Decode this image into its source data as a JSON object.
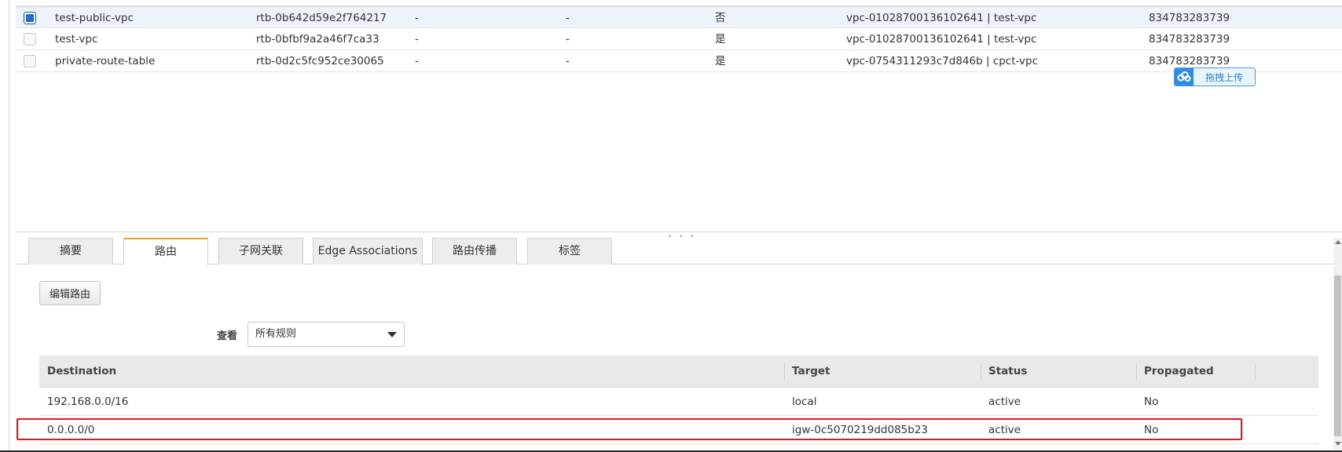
{
  "route_tables": [
    {
      "name": "test-public-vpc",
      "id": "rtb-0b642d59e2f764217",
      "col3": "-",
      "col4": "-",
      "main": "否",
      "vpc": "vpc-01028700136102641 | test-vpc",
      "owner": "834783283739",
      "selected": true
    },
    {
      "name": "test-vpc",
      "id": "rtb-0bfbf9a2a46f7ca33",
      "col3": "-",
      "col4": "-",
      "main": "是",
      "vpc": "vpc-01028700136102641 | test-vpc",
      "owner": "834783283739",
      "selected": false
    },
    {
      "name": "private-route-table",
      "id": "rtb-0d2c5fc952ce30065",
      "col3": "-",
      "col4": "-",
      "main": "是",
      "vpc": "vpc-0754311293c7d846b | cpct-vpc",
      "owner": "834783283739",
      "selected": false
    }
  ],
  "upload_badge": {
    "label": "拖拽上传",
    "icon": "cloud-upload-icon"
  },
  "tabs": [
    {
      "label": "摘要",
      "active": false
    },
    {
      "label": "路由",
      "active": true
    },
    {
      "label": "子网关联",
      "active": false
    },
    {
      "label": "Edge Associations",
      "active": false
    },
    {
      "label": "路由传播",
      "active": false
    },
    {
      "label": "标签",
      "active": false
    }
  ],
  "edit_routes_button": "编辑路由",
  "view_filter": {
    "label": "查看",
    "value": "所有规则"
  },
  "routes_table": {
    "headers": [
      "Destination",
      "Target",
      "Status",
      "Propagated"
    ],
    "rows": [
      {
        "destination": "192.168.0.0/16",
        "target": "local",
        "status": "active",
        "propagated": "No"
      },
      {
        "destination": "0.0.0.0/0",
        "target": "igw-0c5070219dd085b23",
        "status": "active",
        "propagated": "No"
      }
    ]
  },
  "colors": {
    "link": "#2a6ebb",
    "active_status": "#2a8a2a",
    "tab_accent": "#f0a21b",
    "highlight": "#e4161c",
    "checkbox_checked": "#1e6ecf"
  }
}
